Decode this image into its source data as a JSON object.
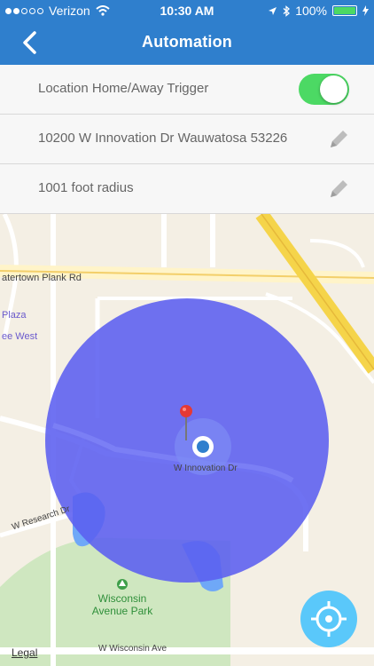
{
  "status_bar": {
    "carrier": "Verizon",
    "time": "10:30 AM",
    "battery": "100%"
  },
  "nav": {
    "title": "Automation"
  },
  "settings": {
    "trigger_label": "Location Home/Away Trigger",
    "trigger_enabled": true,
    "address": "10200 W Innovation Dr Wauwatosa 53226",
    "radius": "1001 foot radius"
  },
  "map": {
    "labels": {
      "watertown_plank": "atertown Plank Rd",
      "plaza": "Plaza",
      "west": "ee West",
      "innovation": "W Innovation Dr",
      "research": "W Research Dr",
      "wisconsin_ave": "W Wisconsin Ave",
      "park_line1": "Wisconsin",
      "park_line2": "Avenue Park"
    },
    "legal": "Legal"
  },
  "colors": {
    "nav_blue": "#2f7fcd",
    "toggle_green": "#4cd964",
    "geofence": "#5b5ff0",
    "locate_button": "#5ac8fa"
  },
  "icons": {
    "back": "chevron-left-icon",
    "edit": "pencil-icon",
    "pin": "map-pin-icon",
    "locate": "crosshair-icon"
  }
}
